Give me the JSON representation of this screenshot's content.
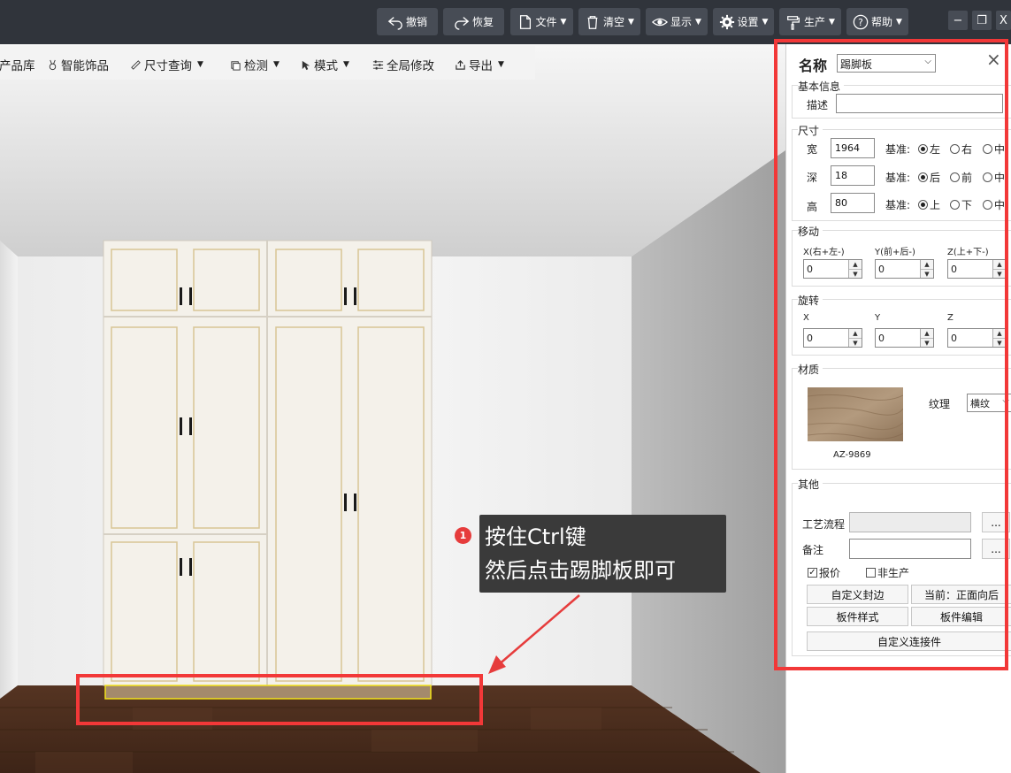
{
  "topbar": {
    "buttons": {
      "undo": "撤销",
      "redo": "恢复",
      "file": "文件",
      "clear": "清空",
      "display": "显示",
      "settings": "设置",
      "production": "生产",
      "help": "帮助"
    },
    "window": {
      "minimize": "−",
      "restore": "❐",
      "close": "X"
    }
  },
  "toolbar2": {
    "items": {
      "product_lib": "产品库",
      "smart_decor": "智能饰品",
      "size_query": "尺寸查询",
      "check": "检测",
      "mode": "模式",
      "global_edit": "全局修改",
      "export": "导出"
    }
  },
  "callout": {
    "number": "1",
    "line1": "按住Ctrl键",
    "line2": "然后点击踢脚板即可"
  },
  "panel": {
    "name_label": "名称",
    "name_value": "踢脚板",
    "basic_info": {
      "title": "基本信息",
      "desc_label": "描述",
      "desc_value": ""
    },
    "size": {
      "title": "尺寸",
      "rows": [
        {
          "label": "宽",
          "value": "1964",
          "base_label": "基准:",
          "options": [
            "左",
            "右",
            "中"
          ],
          "selected": 0
        },
        {
          "label": "深",
          "value": "18",
          "base_label": "基准:",
          "options": [
            "后",
            "前",
            "中"
          ],
          "selected": 0
        },
        {
          "label": "高",
          "value": "80",
          "base_label": "基准:",
          "options": [
            "上",
            "下",
            "中"
          ],
          "selected": 0
        }
      ]
    },
    "move": {
      "title": "移动",
      "fields": [
        {
          "label": "X(右+左-)",
          "value": "0"
        },
        {
          "label": "Y(前+后-)",
          "value": "0"
        },
        {
          "label": "Z(上+下-)",
          "value": "0"
        }
      ]
    },
    "rotate": {
      "title": "旋转",
      "fields": [
        {
          "label": "X",
          "value": "0"
        },
        {
          "label": "Y",
          "value": "0"
        },
        {
          "label": "Z",
          "value": "0"
        }
      ]
    },
    "material": {
      "title": "材质",
      "code": "AZ-9869",
      "texture_label": "纹理",
      "texture_value": "横纹"
    },
    "other": {
      "title": "其他",
      "process_label": "工艺流程",
      "process_value": "",
      "note_label": "备注",
      "note_value": "",
      "ellipsis": "...",
      "quote_label": "报价",
      "quote_checked": true,
      "nonprod_label": "非生产",
      "nonprod_checked": false,
      "btn_custom_edge": "自定义封边",
      "btn_current": "当前：正面向后",
      "btn_panel_style": "板件样式",
      "btn_panel_edit": "板件编辑",
      "btn_custom_connector": "自定义连接件"
    }
  },
  "colors": {
    "highlight_red": "#f23838",
    "topbar": "#30343b",
    "topbar_button": "#474c55",
    "floor": "#4a2c1c",
    "selection_yellow": "#f2e21a"
  }
}
